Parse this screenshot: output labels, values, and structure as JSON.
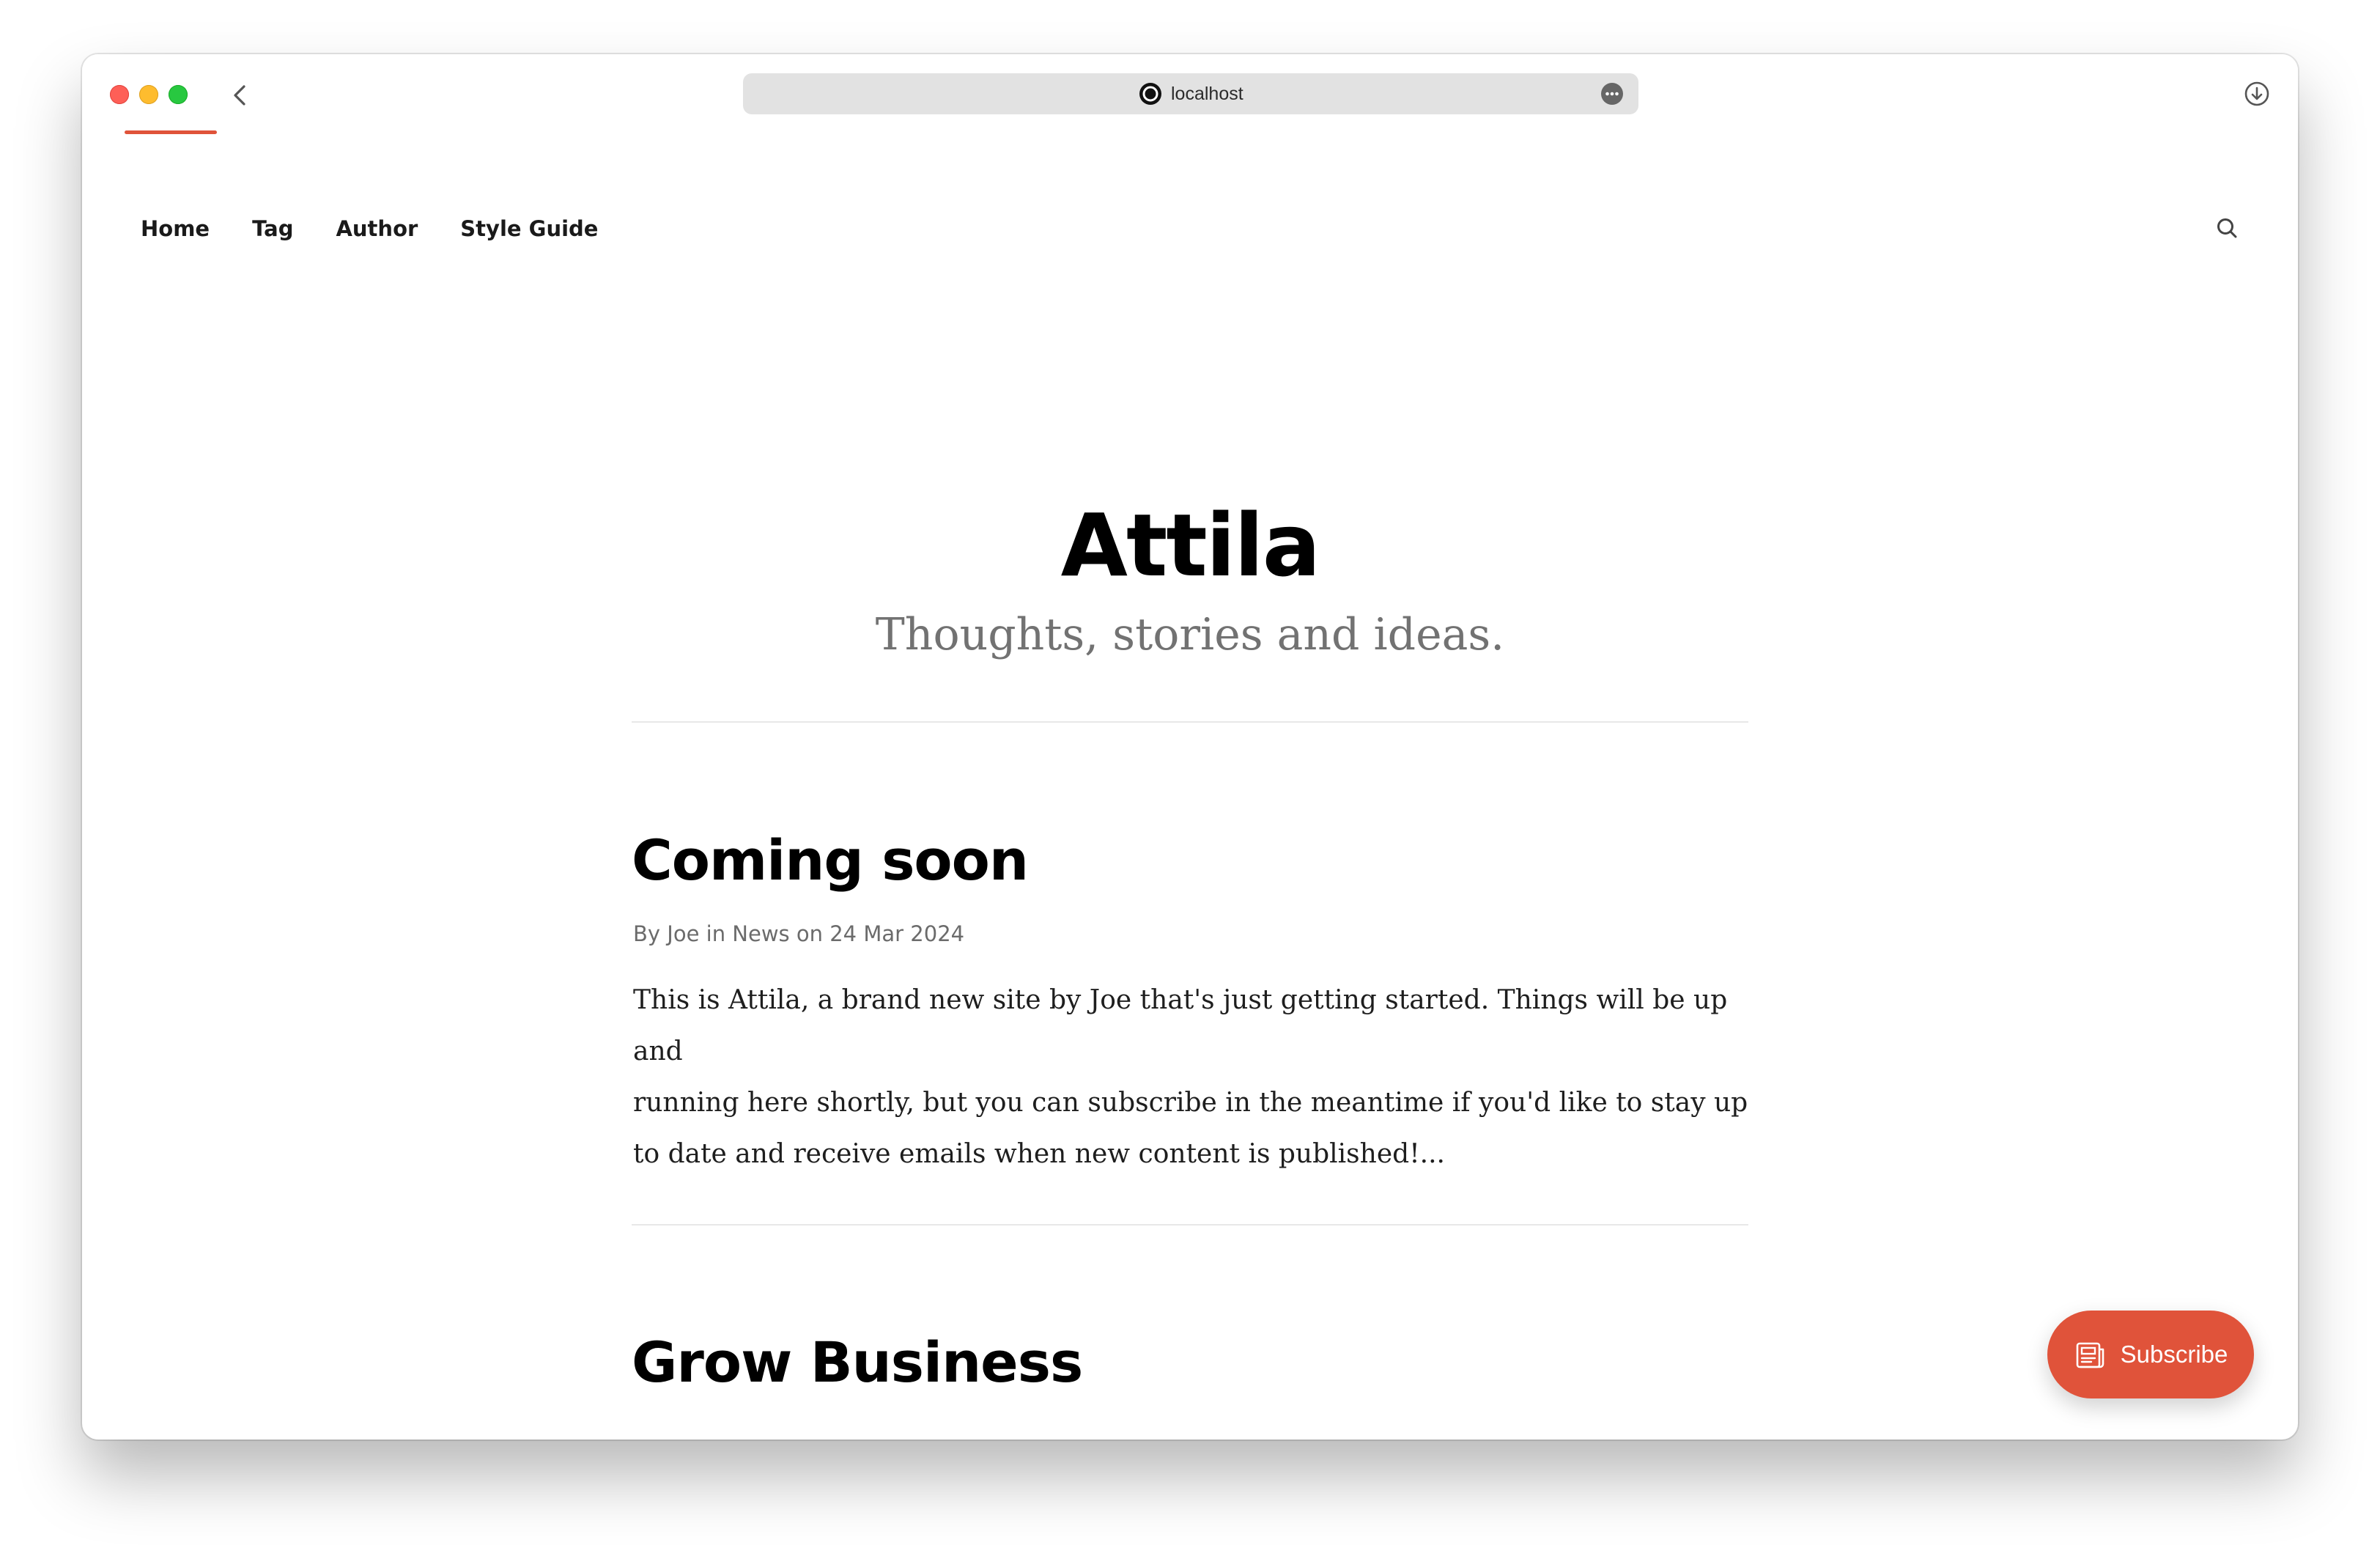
{
  "browser": {
    "url": "localhost",
    "icons": {
      "back": "chevron-left-icon",
      "site": "ghost-site-icon",
      "more": "ellipsis-icon",
      "download": "download-icon"
    }
  },
  "nav": {
    "items": [
      {
        "label": "Home"
      },
      {
        "label": "Tag"
      },
      {
        "label": "Author"
      },
      {
        "label": "Style Guide"
      }
    ],
    "search_icon": "search-icon"
  },
  "hero": {
    "title": "Attila",
    "description": "Thoughts, stories and ideas."
  },
  "posts": [
    {
      "title": "Coming soon",
      "meta": {
        "by": "By",
        "author": "Joe",
        "in": "in",
        "tag": "News",
        "on": "on",
        "date": "24 Mar 2024"
      },
      "excerpt_lines": [
        "This is Attila, a brand new site by Joe that's just getting started. Things will be up and",
        "running here shortly, but you can subscribe in the meantime if you'd like to stay up",
        "to date and receive emails when new content is published!..."
      ]
    },
    {
      "title": "Grow Business"
    }
  ],
  "subscribe": {
    "label": "Subscribe",
    "icon": "newsletter-icon"
  },
  "colors": {
    "accent": "#e0533a",
    "text": "#000000",
    "muted": "#727272",
    "divider": "#e8e8e8"
  }
}
